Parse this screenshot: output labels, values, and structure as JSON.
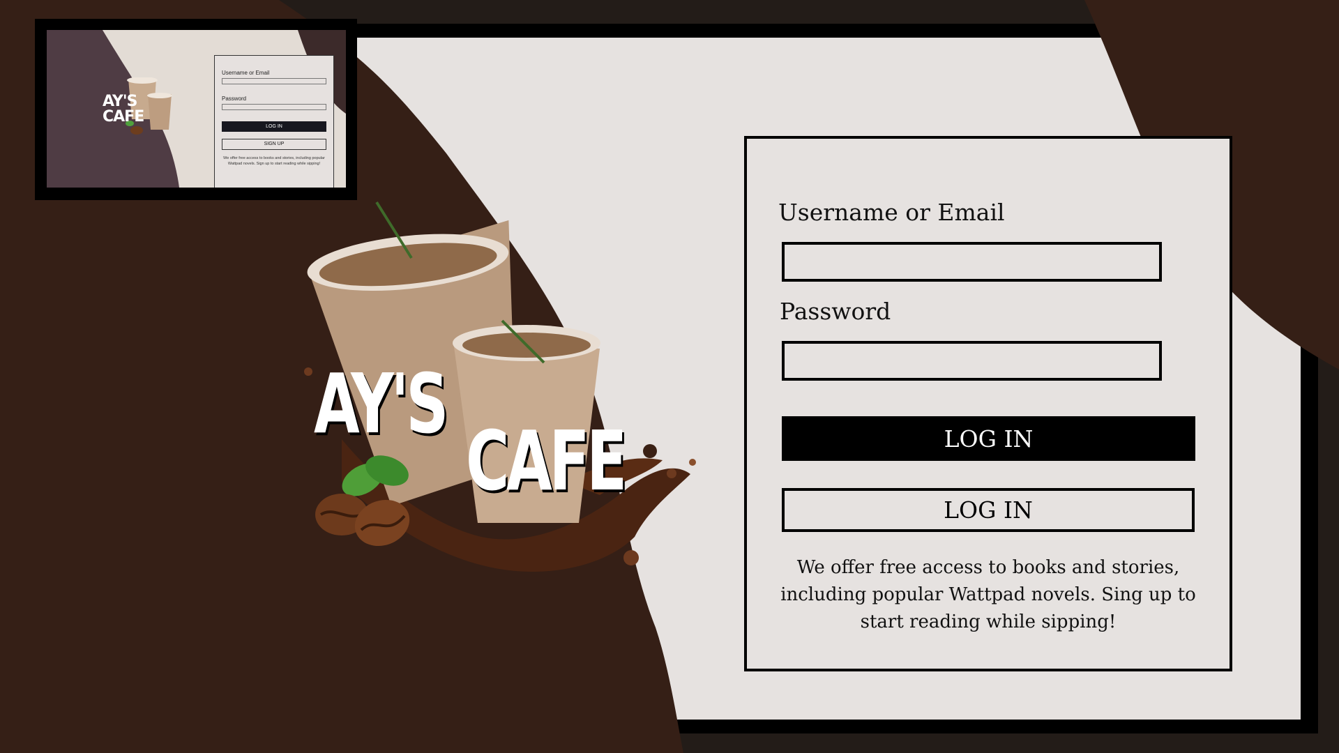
{
  "preview": {
    "logo_text": "AY'S CAFE",
    "username_label": "Username or Email",
    "password_label": "Password",
    "login_label": "LOG IN",
    "signup_label": "SIGN UP",
    "info_text": "We offer free access to books and stories, including popular Wattpad novels. Sign up to start reading while sipping!"
  },
  "brand": {
    "line1": "AY'S",
    "line2": "CAFE"
  },
  "form": {
    "username_label": "Username or Email",
    "username_value": "",
    "password_label": "Password",
    "password_value": "",
    "login_button": "LOG IN",
    "second_button": "LOG IN",
    "info_text": "We offer free access to books and stories, including popular Wattpad novels. Sing up to start reading while sipping!"
  },
  "colors": {
    "brown_dark": "#351f16",
    "panel": "#e6e2e0",
    "frame": "#000000",
    "outer": "#231c18"
  }
}
